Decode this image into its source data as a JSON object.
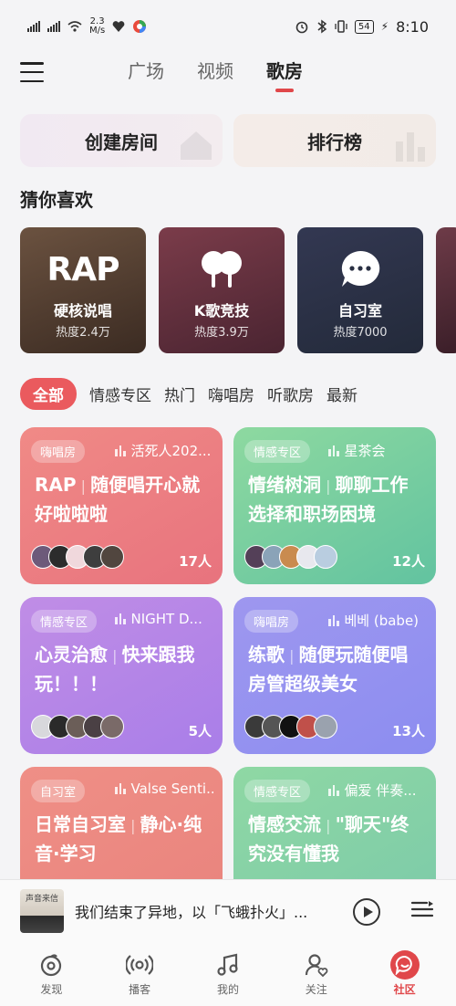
{
  "status_bar": {
    "speed_value": "2.3",
    "speed_unit": "M/s",
    "battery": "54",
    "time": "8:10"
  },
  "header": {
    "tabs": [
      {
        "label": "广场"
      },
      {
        "label": "视频"
      },
      {
        "label": "歌房"
      }
    ],
    "active_tab": 2
  },
  "actions": {
    "create_label": "创建房间",
    "rank_label": "排行榜"
  },
  "guess_section": {
    "title": "猜你喜欢",
    "cards": [
      {
        "icon_text": "RAP",
        "icon": "rap-text-icon",
        "name": "硬核说唱",
        "heat": "热度2.4万"
      },
      {
        "icon": "microphone-duet-icon",
        "name": "K歌竞技",
        "heat": "热度3.9万"
      },
      {
        "icon": "chat-bubble-icon",
        "name": "自习室",
        "heat": "热度7000"
      }
    ]
  },
  "filters": [
    "全部",
    "情感专区",
    "热门",
    "嗨唱房",
    "听歌房",
    "最新"
  ],
  "rooms": [
    {
      "tag": "嗨唱房",
      "host": "活死人202...",
      "title_a": "RAP",
      "title_b": "随便唱开心就好啦啦啦",
      "count": "17人",
      "theme": "g-red"
    },
    {
      "tag": "情感专区",
      "host": "星茶会",
      "title_a": "情绪树洞",
      "title_b": "聊聊工作选择和职场困境",
      "count": "12人",
      "theme": "g-green"
    },
    {
      "tag": "情感专区",
      "host": "NIGHT D...",
      "title_a": "心灵治愈",
      "title_b": "快来跟我玩！！！",
      "count": "5人",
      "theme": "g-purple"
    },
    {
      "tag": "嗨唱房",
      "host": "베베 (babe)",
      "title_a": "练歌",
      "title_b": "随便玩随便唱房管超级美女",
      "count": "13人",
      "theme": "g-blue"
    },
    {
      "tag": "自习室",
      "host": "Valse Senti...",
      "title_a": "日常自习室",
      "title_b": "静心·纯音·学习",
      "count": "",
      "theme": "g-salmon"
    },
    {
      "tag": "情感专区",
      "host": "偏爱 伴奏...",
      "title_a": "情感交流",
      "title_b": "\"聊天\"终究没有懂我",
      "count": "",
      "theme": "g-teal"
    }
  ],
  "player": {
    "cover_label": "声音来信",
    "song": "我们结束了异地，以「飞蛾扑火」..."
  },
  "bottom_nav": [
    {
      "label": "发现",
      "icon": "discover-icon"
    },
    {
      "label": "播客",
      "icon": "podcast-icon"
    },
    {
      "label": "我的",
      "icon": "music-note-icon"
    },
    {
      "label": "关注",
      "icon": "follow-icon"
    },
    {
      "label": "社区",
      "icon": "community-icon"
    }
  ],
  "colors": {
    "accent": "#e0474a",
    "chip_active": "#ea5a5e"
  }
}
